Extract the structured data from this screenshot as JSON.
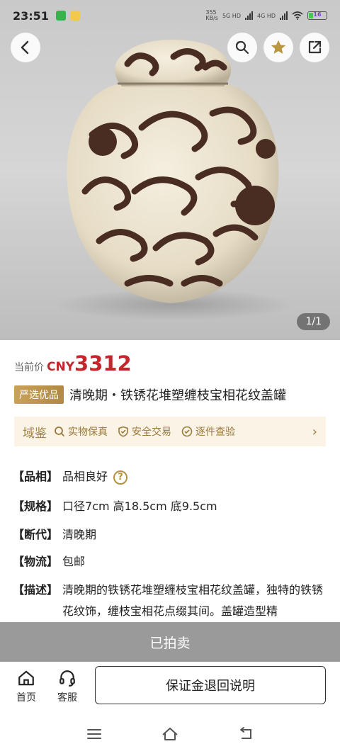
{
  "status": {
    "time": "23:51",
    "net_speed": "355\nKB/s",
    "net1": "5G HD",
    "net2": "4G HD",
    "battery": "16"
  },
  "hero": {
    "counter": "1/1"
  },
  "price": {
    "label": "当前价",
    "currency": "CNY",
    "value": "3312"
  },
  "item": {
    "badge": "严选优品",
    "title": "清晚期・铁锈花堆塑缠枝宝相花纹盖罐"
  },
  "services": {
    "brand": "域鉴",
    "items": [
      "实物保真",
      "安全交易",
      "逐件查验"
    ]
  },
  "specs": [
    {
      "key": "【品相】",
      "value": "品相良好"
    },
    {
      "key": "【规格】",
      "value": "口径7cm 高18.5cm 底9.5cm"
    },
    {
      "key": "【断代】",
      "value": "清晚期"
    },
    {
      "key": "【物流】",
      "value": "包邮"
    },
    {
      "key": "【描述】",
      "value": "清晚期的铁锈花堆塑缠枝宝相花纹盖罐，独特的铁锈花纹饰，缠枝宝相花点缀其间。盖罐造型精"
    }
  ],
  "sold_label": "已拍卖",
  "bottom_nav": {
    "home": "首页",
    "service": "客服",
    "deposit_button": "保证金退回说明"
  },
  "colors": {
    "price": "#c1272d",
    "gold": "#b4913f",
    "sold_bg": "#9a9a9a"
  }
}
